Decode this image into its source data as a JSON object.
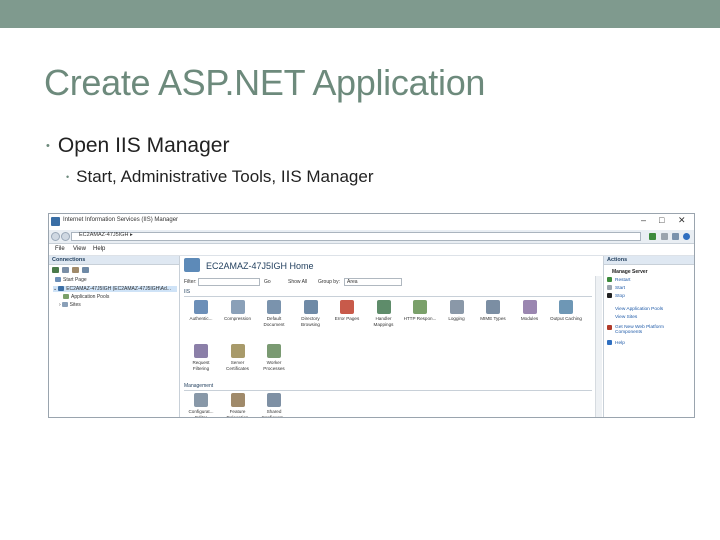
{
  "slide": {
    "title": "Create ASP.NET Application",
    "bullet1": "Open IIS Manager",
    "bullet2": "Start, Administrative Tools, IIS Manager"
  },
  "window": {
    "title": "Internet Information Services (IIS) Manager",
    "controls": [
      "–",
      "□",
      "✕"
    ],
    "address": "EC2AMAZ-47J5IGH  ▸",
    "menu": [
      "File",
      "View",
      "Help"
    ]
  },
  "connections": {
    "header": "Connections",
    "tree": [
      "Start Page",
      "EC2AMAZ-47J5IGH (EC2AMAZ-47J5IGH\\Ad...",
      "Application Pools",
      "Sites"
    ]
  },
  "home": {
    "title": "EC2AMAZ-47J5IGH Home",
    "filter_label": "Filter:",
    "go_label": "Go",
    "show_all_label": "Show All",
    "group_by_label": "Group by:",
    "group_by_value": "Area",
    "section_iis": "IIS",
    "section_management": "Management",
    "features_iis": [
      {
        "label": "Authentic...",
        "icon": "authentication-icon",
        "color": "#6c8fb8"
      },
      {
        "label": "Compression",
        "icon": "compression-icon",
        "color": "#8aa0b8"
      },
      {
        "label": "Default Document",
        "icon": "default-document-icon",
        "color": "#7a93ad"
      },
      {
        "label": "Directory Browsing",
        "icon": "directory-browsing-icon",
        "color": "#6f8aa6"
      },
      {
        "label": "Error Pages",
        "icon": "error-pages-icon",
        "color": "#c85a4a"
      },
      {
        "label": "Handler Mappings",
        "icon": "handler-mappings-icon",
        "color": "#5e8c6a"
      },
      {
        "label": "HTTP Respon...",
        "icon": "http-response-icon",
        "color": "#7aa06a"
      },
      {
        "label": "Logging",
        "icon": "logging-icon",
        "color": "#8a98a8"
      },
      {
        "label": "MIME Types",
        "icon": "mime-types-icon",
        "color": "#7b8ea3"
      },
      {
        "label": "Modules",
        "icon": "modules-icon",
        "color": "#9a86b0"
      },
      {
        "label": "Output Caching",
        "icon": "output-caching-icon",
        "color": "#6e97b5"
      }
    ],
    "features_iis_row2": [
      {
        "label": "Request Filtering",
        "icon": "request-filtering-icon",
        "color": "#8b7fa8"
      },
      {
        "label": "Server Certificates",
        "icon": "server-certificates-icon",
        "color": "#a89a6a"
      },
      {
        "label": "Worker Processes",
        "icon": "worker-processes-icon",
        "color": "#7a9a72"
      }
    ],
    "features_management": [
      {
        "label": "Configurat... Editor",
        "icon": "configuration-editor-icon",
        "color": "#8898a8"
      },
      {
        "label": "Feature Delegation",
        "icon": "feature-delegation-icon",
        "color": "#a08a6a"
      },
      {
        "label": "Shared Configurat...",
        "icon": "shared-configuration-icon",
        "color": "#7e90a4"
      }
    ]
  },
  "actions": {
    "header": "Actions",
    "manage_server": "Manage Server",
    "items": [
      {
        "label": "Restart",
        "icon": "restart-icon",
        "color": "#3c8a3c"
      },
      {
        "label": "Start",
        "icon": "start-icon",
        "color": "#9aa4ae"
      },
      {
        "label": "Stop",
        "icon": "stop-icon",
        "color": "#222222"
      },
      {
        "label": "View Application Pools",
        "icon": "none",
        "color": ""
      },
      {
        "label": "View Sites",
        "icon": "none",
        "color": ""
      },
      {
        "label": "Get New Web Platform Components",
        "icon": "web-platform-icon",
        "color": "#b03a2a"
      },
      {
        "label": "Help",
        "icon": "help-icon",
        "color": "#2f6fc0"
      }
    ]
  },
  "colors": {
    "accent": "#6d8a7c",
    "topbar": "#7f9a8e",
    "link": "#1e5aa8"
  }
}
